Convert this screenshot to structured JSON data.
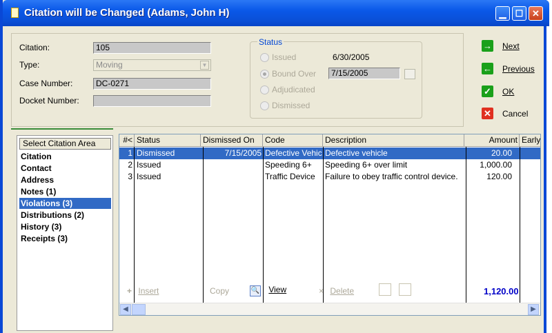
{
  "window": {
    "title": "Citation will be Changed  (Adams, John H)"
  },
  "form": {
    "citation_label": "Citation:",
    "citation_value": "105",
    "type_label": "Type:",
    "type_value": "Moving",
    "case_number_label": "Case Number:",
    "case_number_value": "DC-0271",
    "docket_number_label": "Docket Number:",
    "docket_number_value": ""
  },
  "status": {
    "legend": "Status",
    "options": [
      {
        "label": "Issued",
        "date": "6/30/2005",
        "selected": false
      },
      {
        "label": "Bound Over",
        "date": "7/15/2005",
        "selected": true
      },
      {
        "label": "Adjudicated",
        "date": "",
        "selected": false
      },
      {
        "label": "Dismissed",
        "date": "",
        "selected": false
      }
    ]
  },
  "actions": {
    "next": "Next",
    "previous": "Previous",
    "ok": "OK",
    "cancel": "Cancel"
  },
  "area": {
    "header": "Select Citation Area",
    "items": [
      {
        "label": "Citation",
        "selected": false
      },
      {
        "label": "Contact",
        "selected": false
      },
      {
        "label": "Address",
        "selected": false
      },
      {
        "label": "Notes (1)",
        "selected": false
      },
      {
        "label": "Violations (3)",
        "selected": true
      },
      {
        "label": "Distributions (2)",
        "selected": false
      },
      {
        "label": "History (3)",
        "selected": false
      },
      {
        "label": "Receipts (3)",
        "selected": false
      }
    ]
  },
  "grid": {
    "columns": [
      "#<",
      "Status",
      "Dismissed On",
      "Code",
      "Description",
      "Amount",
      "Early"
    ],
    "rows": [
      {
        "num": "1",
        "status": "Dismissed",
        "dismissed_on": "7/15/2005",
        "code": "Defective Vehic",
        "description": "Defective vehicle",
        "amount": "20.00",
        "selected": true
      },
      {
        "num": "2",
        "status": "Issued",
        "dismissed_on": "",
        "code": "Speeding 6+",
        "description": "Speeding 6+ over limit",
        "amount": "1,000.00",
        "selected": false
      },
      {
        "num": "3",
        "status": "Issued",
        "dismissed_on": "",
        "code": "Traffic Device",
        "description": "Failure to obey traffic control device.",
        "amount": "120.00",
        "selected": false
      }
    ]
  },
  "toolbar": {
    "insert": "Insert",
    "copy": "Copy",
    "view": "View",
    "delete": "Delete",
    "total": "1,120.00"
  },
  "colors": {
    "title_bar": "#0a58e8",
    "selection": "#316ac5",
    "next_icon": "#1aa01a",
    "cancel_icon": "#e03020",
    "total_text": "#0000c8"
  }
}
